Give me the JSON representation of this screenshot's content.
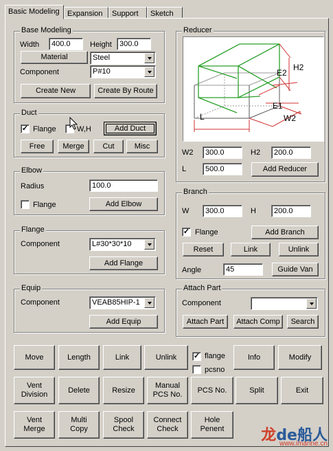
{
  "tabs": [
    "Basic Modeling",
    "Expansion",
    "Support",
    "Sketch"
  ],
  "base_modeling": {
    "title": "Base Modeling",
    "width_label": "Width",
    "width_value": "400.0",
    "height_label": "Height",
    "height_value": "300.0",
    "material_button": "Material",
    "material_value": "Steel",
    "component_label": "Component",
    "component_value": "P#10",
    "create_new": "Create New",
    "create_by_route": "Create By Route"
  },
  "duct": {
    "title": "Duct",
    "flange_label": "Flange",
    "flange_checked": true,
    "wh_label": "W,H",
    "wh_checked": false,
    "add_duct": "Add Duct",
    "free": "Free",
    "merge": "Merge",
    "cut": "Cut",
    "misc": "Misc"
  },
  "elbow": {
    "title": "Elbow",
    "radius_label": "Radius",
    "radius_value": "100.0",
    "flange_label": "Flange",
    "flange_checked": false,
    "add_elbow": "Add Elbow"
  },
  "flange": {
    "title": "Flange",
    "component_label": "Component",
    "component_value": "L#30*30*10",
    "add_flange": "Add Flange"
  },
  "equip": {
    "title": "Equip",
    "component_label": "Component",
    "component_value": "VEAB85HIP-1",
    "add_equip": "Add Equip"
  },
  "reducer": {
    "title": "Reducer",
    "diagram_labels": {
      "h2": "H2",
      "e2": "E2",
      "e1": "E1",
      "w2": "W2",
      "l": "L"
    },
    "w2_label": "W2",
    "w2_value": "300.0",
    "h2_label": "H2",
    "h2_value": "200.0",
    "l_label": "L",
    "l_value": "500.0",
    "add_reducer": "Add Reducer"
  },
  "branch": {
    "title": "Branch",
    "w_label": "W",
    "w_value": "300.0",
    "h_label": "H",
    "h_value": "200.0",
    "flange_label": "Flange",
    "flange_checked": true,
    "add_branch": "Add Branch",
    "reset": "Reset",
    "link": "Link",
    "unlink": "Unlink",
    "angle_label": "Angle",
    "angle_value": "45",
    "guide_van": "Guide Van"
  },
  "attach_part": {
    "title": "Attach Part",
    "component_label": "Component",
    "component_value": "",
    "attach_part": "Attach Part",
    "attach_comp": "Attach Comp",
    "search": "Search"
  },
  "bottom_row1": {
    "move": "Move",
    "length": "Length",
    "link": "Link",
    "unlink": "Unlink",
    "flange_label": "flange",
    "flange_checked": true,
    "pcsno_label": "pcsno",
    "pcsno_checked": false,
    "info": "Info",
    "modify": "Modify"
  },
  "bottom_row2": {
    "vent_division": "Vent\nDivision",
    "delete": "Delete",
    "resize": "Resize",
    "manual_pcs_no": "Manual\nPCS No.",
    "pcs_no": "PCS No.",
    "split": "Split",
    "exit": "Exit"
  },
  "bottom_row3": {
    "vent_merge": "Vent\nMerge",
    "multi_copy": "Multi\nCopy",
    "spool_check": "Spool\nCheck",
    "connect_check": "Connect\nCheck",
    "hole_penent": "Hole\nPenent"
  },
  "watermark": {
    "logo_a": "龙",
    "logo_b": "de",
    "logo_c": "船人",
    "url": "www.imanne.cn"
  },
  "colors": {
    "face": "#d4d0c8",
    "diagram_green": "#2aa02a",
    "diagram_red": "#d03030"
  }
}
